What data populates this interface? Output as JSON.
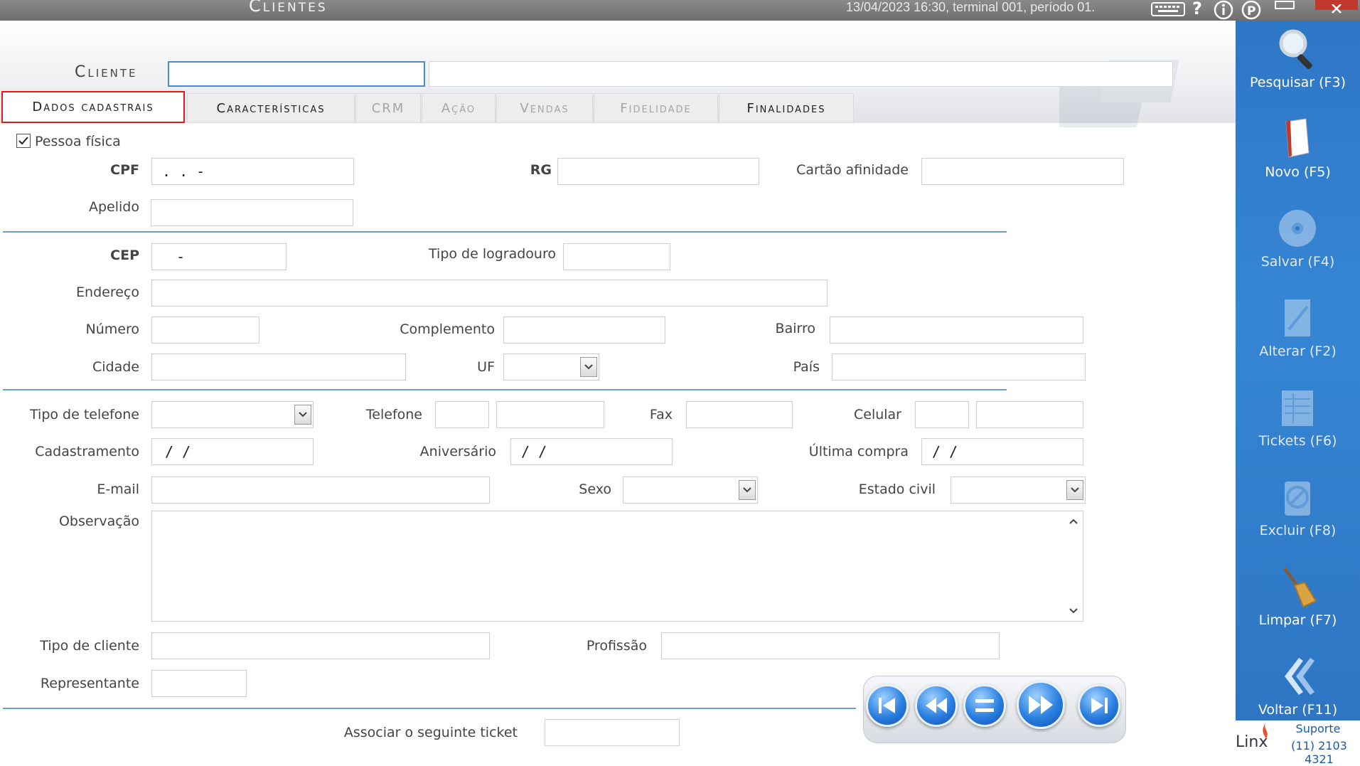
{
  "window": {
    "title": "Clientes",
    "datetime": "13/04/2023 16:30, terminal 001, período 01."
  },
  "titlebar_icons": [
    "keyboard-icon",
    "help-icon",
    "info-icon",
    "p-icon",
    "minimize-icon",
    "close-icon"
  ],
  "header": {
    "cliente_label": "Cliente",
    "cliente_code_value": "",
    "cliente_name_value": ""
  },
  "tabs": [
    {
      "label": "Dados cadastrais",
      "state": "active"
    },
    {
      "label": "Características",
      "state": "enabled"
    },
    {
      "label": "CRM",
      "state": "disabled"
    },
    {
      "label": "Ação",
      "state": "disabled"
    },
    {
      "label": "Vendas",
      "state": "disabled"
    },
    {
      "label": "Fidelidade",
      "state": "disabled"
    },
    {
      "label": "Finalidades",
      "state": "enabled"
    }
  ],
  "form": {
    "pessoa_fisica": {
      "label": "Pessoa física",
      "checked": true
    },
    "cpf": {
      "label": "CPF",
      "value": ". . -"
    },
    "rg": {
      "label": "RG",
      "value": ""
    },
    "cartao_afinidade": {
      "label": "Cartão afinidade",
      "value": ""
    },
    "apelido": {
      "label": "Apelido",
      "value": ""
    },
    "cep": {
      "label": "CEP",
      "value": "-"
    },
    "tipo_logradouro": {
      "label": "Tipo de logradouro",
      "value": ""
    },
    "endereco": {
      "label": "Endereço",
      "value": ""
    },
    "numero": {
      "label": "Número",
      "value": ""
    },
    "complemento": {
      "label": "Complemento",
      "value": ""
    },
    "bairro": {
      "label": "Bairro",
      "value": ""
    },
    "cidade": {
      "label": "Cidade",
      "value": ""
    },
    "uf": {
      "label": "UF",
      "value": ""
    },
    "pais": {
      "label": "País",
      "value": ""
    },
    "tipo_telefone": {
      "label": "Tipo de telefone",
      "value": ""
    },
    "telefone": {
      "label": "Telefone",
      "ddd": "",
      "value": ""
    },
    "fax": {
      "label": "Fax",
      "value": ""
    },
    "celular": {
      "label": "Celular",
      "ddd": "",
      "value": ""
    },
    "cadastramento": {
      "label": "Cadastramento",
      "value": "/ /"
    },
    "aniversario": {
      "label": "Aniversário",
      "value": "/ /"
    },
    "ultima_compra": {
      "label": "Última compra",
      "value": "/ /"
    },
    "email": {
      "label": "E-mail",
      "value": ""
    },
    "sexo": {
      "label": "Sexo",
      "value": ""
    },
    "estado_civil": {
      "label": "Estado civil",
      "value": ""
    },
    "observacao": {
      "label": "Observação",
      "value": ""
    },
    "tipo_cliente": {
      "label": "Tipo de cliente",
      "value": ""
    },
    "profissao": {
      "label": "Profissão",
      "value": ""
    },
    "representante": {
      "label": "Representante",
      "value": ""
    },
    "associar_ticket": {
      "label": "Associar o seguinte ticket",
      "value": ""
    }
  },
  "sidebar": {
    "buttons": [
      {
        "label": "Pesquisar (F3)",
        "icon": "magnifier-icon",
        "enabled": true
      },
      {
        "label": "Novo (F5)",
        "icon": "new-document-icon",
        "enabled": true
      },
      {
        "label": "Salvar (F4)",
        "icon": "disc-save-icon",
        "enabled": false
      },
      {
        "label": "Alterar (F2)",
        "icon": "edit-document-icon",
        "enabled": false
      },
      {
        "label": "Tickets (F6)",
        "icon": "tickets-icon",
        "enabled": false
      },
      {
        "label": "Excluir (F8)",
        "icon": "delete-icon",
        "enabled": false
      },
      {
        "label": "Limpar (F7)",
        "icon": "broom-icon",
        "enabled": true
      },
      {
        "label": "Voltar (F11)",
        "icon": "back-arrows-icon",
        "enabled": true
      }
    ],
    "support": {
      "brand": "Linx",
      "title": "Suporte",
      "phone": "(11) 2103 4321"
    }
  },
  "navigation": [
    "first-record-icon",
    "previous-record-icon",
    "current-record-icon",
    "next-record-icon",
    "last-record-icon"
  ],
  "colors": {
    "accent": "#2e76c6",
    "active_tab_border": "#e01b1b",
    "separator": "#6aa0d6",
    "focus_border": "#4a8ad0"
  }
}
